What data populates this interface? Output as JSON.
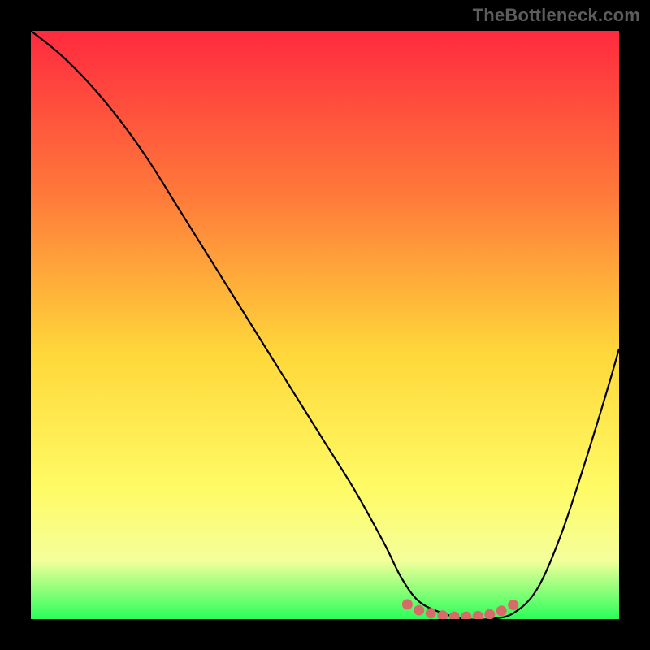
{
  "watermark": "TheBottleneck.com",
  "colors": {
    "frame_bg": "#000000",
    "gradient_top": "#ff2a3f",
    "gradient_mid_upper": "#ff7a3a",
    "gradient_mid": "#ffd83a",
    "gradient_low": "#fffb66",
    "gradient_lower": "#f4ff9a",
    "gradient_bottom": "#2aff5a",
    "curve": "#000000",
    "marker": "#d96a6a"
  },
  "chart_data": {
    "type": "line",
    "title": "",
    "xlabel": "",
    "ylabel": "",
    "xlim": [
      0,
      100
    ],
    "ylim": [
      0,
      100
    ],
    "series": [
      {
        "name": "curve",
        "x": [
          0,
          5,
          10,
          15,
          20,
          25,
          30,
          35,
          40,
          45,
          50,
          55,
          60,
          63,
          66,
          70,
          74,
          78,
          82,
          86,
          90,
          94,
          98,
          100
        ],
        "y": [
          100,
          96,
          91,
          85,
          78,
          70,
          62,
          54,
          46,
          38,
          30,
          22,
          13,
          7,
          3,
          1,
          0,
          0,
          1,
          5,
          14,
          26,
          39,
          46
        ]
      }
    ],
    "markers": {
      "name": "flat-region",
      "x": [
        64,
        66,
        68,
        70,
        72,
        74,
        76,
        78,
        80,
        82
      ],
      "y": [
        2.5,
        1.5,
        1.0,
        0.6,
        0.4,
        0.4,
        0.5,
        0.8,
        1.4,
        2.4
      ]
    }
  }
}
